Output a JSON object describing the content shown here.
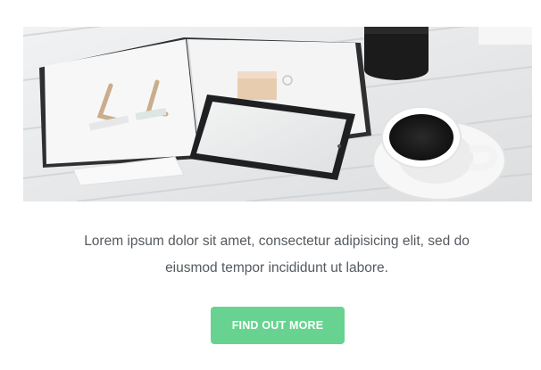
{
  "hero": {
    "image_description_icon": "desk-photo"
  },
  "body": {
    "line1": "Lorem ipsum dolor sit amet, consectetur adipisicing elit, sed do",
    "line2": "eiusmod tempor incididunt ut labore."
  },
  "cta": {
    "label": "FIND OUT MORE",
    "color": "#68d391"
  }
}
